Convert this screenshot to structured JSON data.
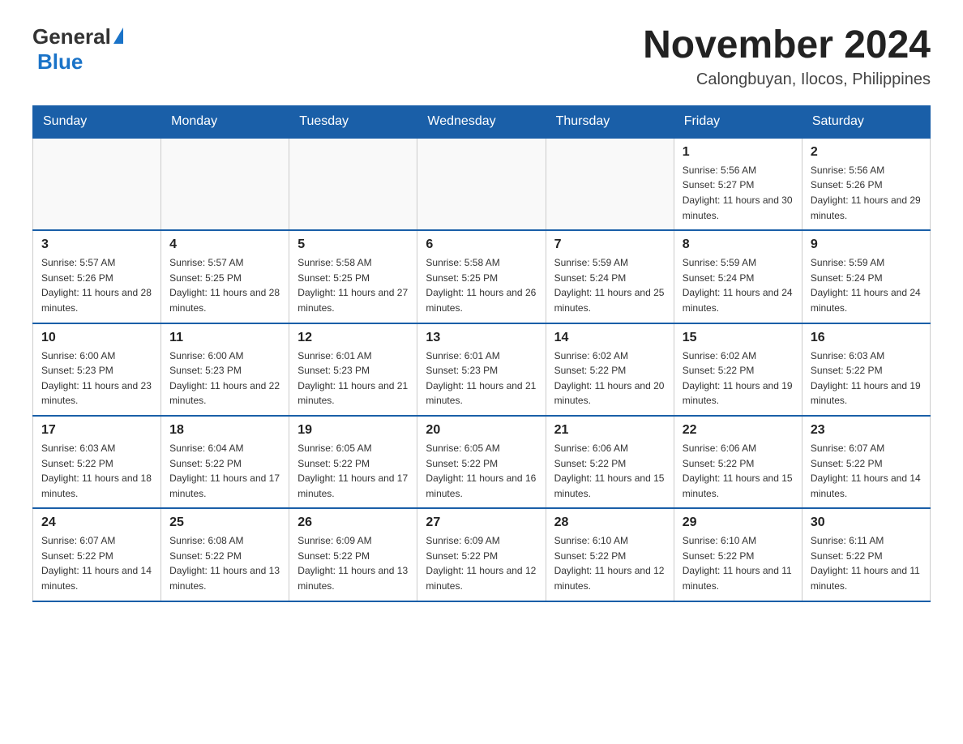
{
  "header": {
    "logo_general": "General",
    "logo_blue": "Blue",
    "month_title": "November 2024",
    "location": "Calongbuyan, Ilocos, Philippines"
  },
  "days_of_week": [
    "Sunday",
    "Monday",
    "Tuesday",
    "Wednesday",
    "Thursday",
    "Friday",
    "Saturday"
  ],
  "weeks": [
    [
      {
        "day": "",
        "sunrise": "",
        "sunset": "",
        "daylight": ""
      },
      {
        "day": "",
        "sunrise": "",
        "sunset": "",
        "daylight": ""
      },
      {
        "day": "",
        "sunrise": "",
        "sunset": "",
        "daylight": ""
      },
      {
        "day": "",
        "sunrise": "",
        "sunset": "",
        "daylight": ""
      },
      {
        "day": "",
        "sunrise": "",
        "sunset": "",
        "daylight": ""
      },
      {
        "day": "1",
        "sunrise": "Sunrise: 5:56 AM",
        "sunset": "Sunset: 5:27 PM",
        "daylight": "Daylight: 11 hours and 30 minutes."
      },
      {
        "day": "2",
        "sunrise": "Sunrise: 5:56 AM",
        "sunset": "Sunset: 5:26 PM",
        "daylight": "Daylight: 11 hours and 29 minutes."
      }
    ],
    [
      {
        "day": "3",
        "sunrise": "Sunrise: 5:57 AM",
        "sunset": "Sunset: 5:26 PM",
        "daylight": "Daylight: 11 hours and 28 minutes."
      },
      {
        "day": "4",
        "sunrise": "Sunrise: 5:57 AM",
        "sunset": "Sunset: 5:25 PM",
        "daylight": "Daylight: 11 hours and 28 minutes."
      },
      {
        "day": "5",
        "sunrise": "Sunrise: 5:58 AM",
        "sunset": "Sunset: 5:25 PM",
        "daylight": "Daylight: 11 hours and 27 minutes."
      },
      {
        "day": "6",
        "sunrise": "Sunrise: 5:58 AM",
        "sunset": "Sunset: 5:25 PM",
        "daylight": "Daylight: 11 hours and 26 minutes."
      },
      {
        "day": "7",
        "sunrise": "Sunrise: 5:59 AM",
        "sunset": "Sunset: 5:24 PM",
        "daylight": "Daylight: 11 hours and 25 minutes."
      },
      {
        "day": "8",
        "sunrise": "Sunrise: 5:59 AM",
        "sunset": "Sunset: 5:24 PM",
        "daylight": "Daylight: 11 hours and 24 minutes."
      },
      {
        "day": "9",
        "sunrise": "Sunrise: 5:59 AM",
        "sunset": "Sunset: 5:24 PM",
        "daylight": "Daylight: 11 hours and 24 minutes."
      }
    ],
    [
      {
        "day": "10",
        "sunrise": "Sunrise: 6:00 AM",
        "sunset": "Sunset: 5:23 PM",
        "daylight": "Daylight: 11 hours and 23 minutes."
      },
      {
        "day": "11",
        "sunrise": "Sunrise: 6:00 AM",
        "sunset": "Sunset: 5:23 PM",
        "daylight": "Daylight: 11 hours and 22 minutes."
      },
      {
        "day": "12",
        "sunrise": "Sunrise: 6:01 AM",
        "sunset": "Sunset: 5:23 PM",
        "daylight": "Daylight: 11 hours and 21 minutes."
      },
      {
        "day": "13",
        "sunrise": "Sunrise: 6:01 AM",
        "sunset": "Sunset: 5:23 PM",
        "daylight": "Daylight: 11 hours and 21 minutes."
      },
      {
        "day": "14",
        "sunrise": "Sunrise: 6:02 AM",
        "sunset": "Sunset: 5:22 PM",
        "daylight": "Daylight: 11 hours and 20 minutes."
      },
      {
        "day": "15",
        "sunrise": "Sunrise: 6:02 AM",
        "sunset": "Sunset: 5:22 PM",
        "daylight": "Daylight: 11 hours and 19 minutes."
      },
      {
        "day": "16",
        "sunrise": "Sunrise: 6:03 AM",
        "sunset": "Sunset: 5:22 PM",
        "daylight": "Daylight: 11 hours and 19 minutes."
      }
    ],
    [
      {
        "day": "17",
        "sunrise": "Sunrise: 6:03 AM",
        "sunset": "Sunset: 5:22 PM",
        "daylight": "Daylight: 11 hours and 18 minutes."
      },
      {
        "day": "18",
        "sunrise": "Sunrise: 6:04 AM",
        "sunset": "Sunset: 5:22 PM",
        "daylight": "Daylight: 11 hours and 17 minutes."
      },
      {
        "day": "19",
        "sunrise": "Sunrise: 6:05 AM",
        "sunset": "Sunset: 5:22 PM",
        "daylight": "Daylight: 11 hours and 17 minutes."
      },
      {
        "day": "20",
        "sunrise": "Sunrise: 6:05 AM",
        "sunset": "Sunset: 5:22 PM",
        "daylight": "Daylight: 11 hours and 16 minutes."
      },
      {
        "day": "21",
        "sunrise": "Sunrise: 6:06 AM",
        "sunset": "Sunset: 5:22 PM",
        "daylight": "Daylight: 11 hours and 15 minutes."
      },
      {
        "day": "22",
        "sunrise": "Sunrise: 6:06 AM",
        "sunset": "Sunset: 5:22 PM",
        "daylight": "Daylight: 11 hours and 15 minutes."
      },
      {
        "day": "23",
        "sunrise": "Sunrise: 6:07 AM",
        "sunset": "Sunset: 5:22 PM",
        "daylight": "Daylight: 11 hours and 14 minutes."
      }
    ],
    [
      {
        "day": "24",
        "sunrise": "Sunrise: 6:07 AM",
        "sunset": "Sunset: 5:22 PM",
        "daylight": "Daylight: 11 hours and 14 minutes."
      },
      {
        "day": "25",
        "sunrise": "Sunrise: 6:08 AM",
        "sunset": "Sunset: 5:22 PM",
        "daylight": "Daylight: 11 hours and 13 minutes."
      },
      {
        "day": "26",
        "sunrise": "Sunrise: 6:09 AM",
        "sunset": "Sunset: 5:22 PM",
        "daylight": "Daylight: 11 hours and 13 minutes."
      },
      {
        "day": "27",
        "sunrise": "Sunrise: 6:09 AM",
        "sunset": "Sunset: 5:22 PM",
        "daylight": "Daylight: 11 hours and 12 minutes."
      },
      {
        "day": "28",
        "sunrise": "Sunrise: 6:10 AM",
        "sunset": "Sunset: 5:22 PM",
        "daylight": "Daylight: 11 hours and 12 minutes."
      },
      {
        "day": "29",
        "sunrise": "Sunrise: 6:10 AM",
        "sunset": "Sunset: 5:22 PM",
        "daylight": "Daylight: 11 hours and 11 minutes."
      },
      {
        "day": "30",
        "sunrise": "Sunrise: 6:11 AM",
        "sunset": "Sunset: 5:22 PM",
        "daylight": "Daylight: 11 hours and 11 minutes."
      }
    ]
  ]
}
